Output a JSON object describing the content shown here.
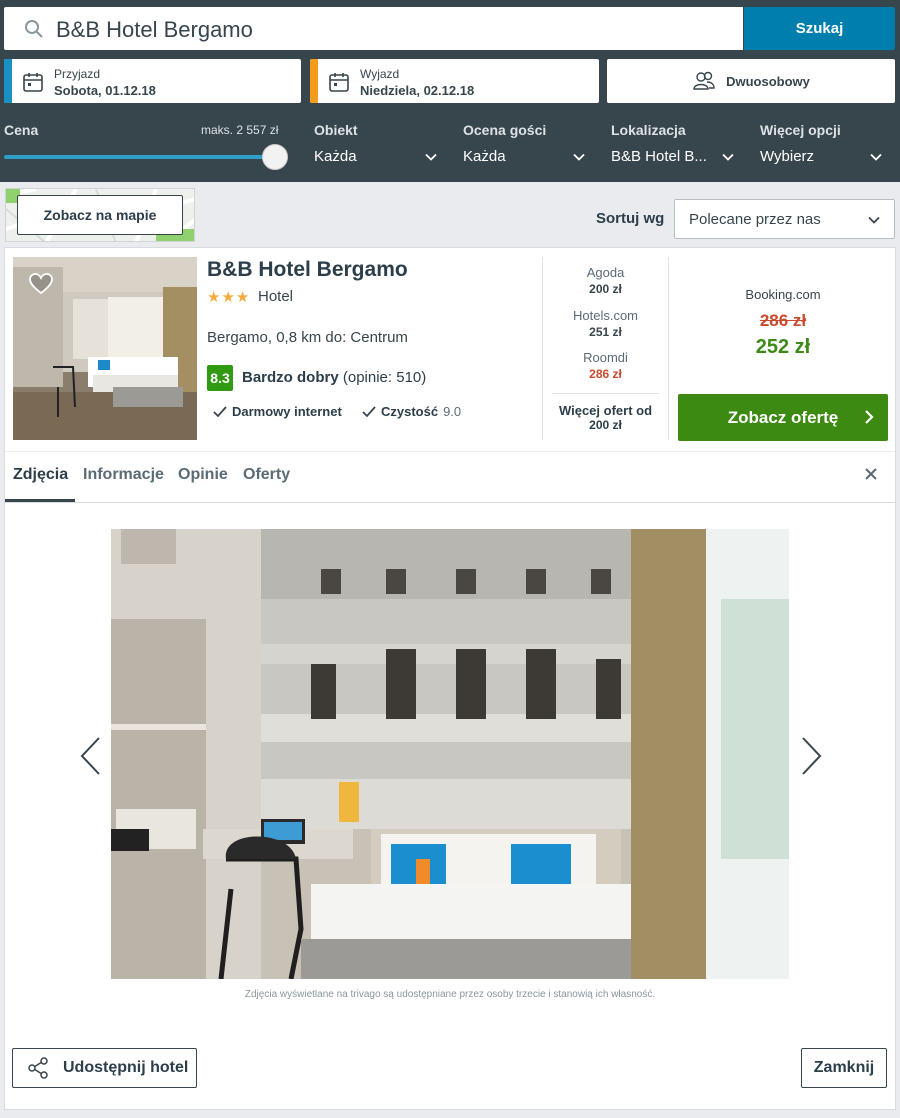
{
  "search": {
    "query": "B&B Hotel Bergamo",
    "button_label": "Szukaj"
  },
  "dates": {
    "checkin": {
      "label": "Przyjazd",
      "value": "Sobota, 01.12.18",
      "accent": "#1a8fc1"
    },
    "checkout": {
      "label": "Wyjazd",
      "value": "Niedziela, 02.12.18",
      "accent": "#f29b1d"
    }
  },
  "room": {
    "label": "Dwuosobowy"
  },
  "filters": {
    "price": {
      "label": "Cena",
      "max": "maks. 2 557 zł"
    },
    "property": {
      "label": "Obiekt",
      "value": "Każda"
    },
    "rating": {
      "label": "Ocena gości",
      "value": "Każda"
    },
    "location": {
      "label": "Lokalizacja",
      "value": "B&B Hotel B..."
    },
    "more": {
      "label": "Więcej opcji",
      "value": "Wybierz"
    }
  },
  "map": {
    "button_label": "Zobacz na mapie"
  },
  "sort": {
    "label": "Sortuj wg",
    "value": "Polecane przez nas"
  },
  "hotel": {
    "name": "B&B Hotel Bergamo",
    "stars": "★★★",
    "type": "Hotel",
    "location": "Bergamo, 0,8 km do: Centrum",
    "rating_score": "8.3",
    "rating_label": "Bardzo dobry",
    "rating_count": "(opinie: 510)",
    "amenities": [
      {
        "label": "Darmowy internet",
        "score": ""
      },
      {
        "label": "Czystość",
        "score": "9.0"
      }
    ],
    "deals": [
      {
        "name": "Agoda",
        "price": "200 zł"
      },
      {
        "name": "Hotels.com",
        "price": "251 zł"
      },
      {
        "name": "Roomdi",
        "price": "286 zł"
      }
    ],
    "more_deals_label": "Więcej ofert od",
    "more_deals_price": "200 zł",
    "best": {
      "provider": "Booking.com",
      "old_price": "286 zł",
      "price": "252 zł",
      "cta": "Zobacz ofertę"
    }
  },
  "tabs": [
    "Zdjęcia",
    "Informacje",
    "Opinie",
    "Oferty"
  ],
  "gallery": {
    "caption": "Zdjęcia wyświetlane na trivago są udostępniane przez osoby trzecie i stanowią ich własność."
  },
  "footer": {
    "share_label": "Udostępnij hotel",
    "close_label": "Zamknij"
  },
  "colors": {
    "header_bg": "#37454d",
    "search_button": "#007faf",
    "cta_green": "#3c8a12",
    "rating_green": "#319a13",
    "price_red": "#c94a2c"
  }
}
